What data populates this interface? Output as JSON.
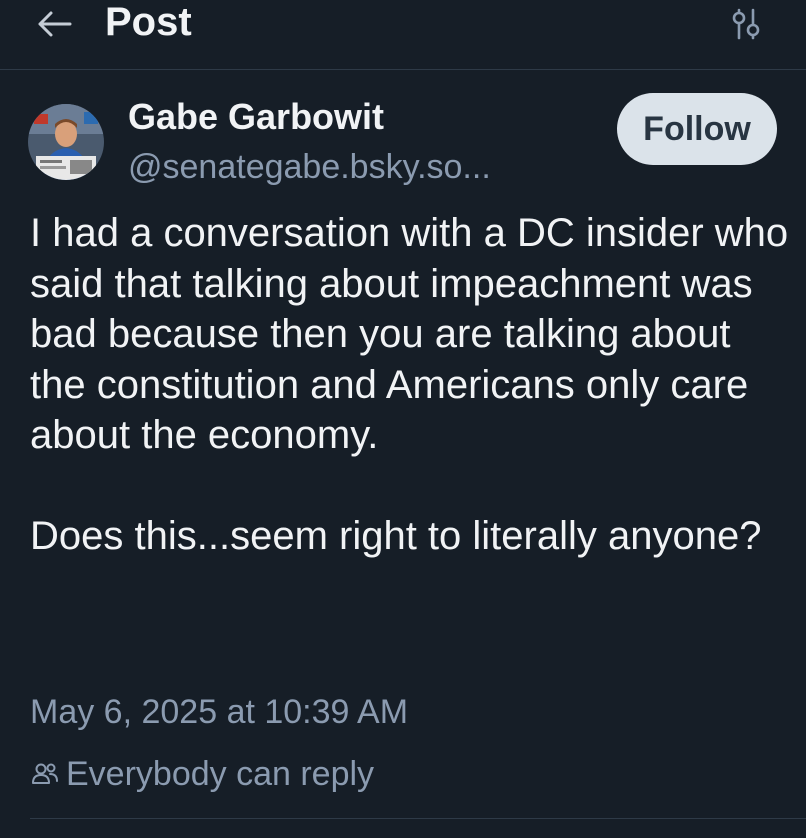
{
  "header": {
    "title": "Post",
    "back_icon": "arrow-left-icon",
    "options_icon": "sliders-icon"
  },
  "author": {
    "name": "Gabe Garbowit",
    "handle": "@senategabe.bsky.so...",
    "follow_label": "Follow"
  },
  "post": {
    "text": "I had a conversation with a DC insider who said that talking about impeachment was bad because then you are talking about the constitution and Americans only care about the economy.\n\nDoes this...seem right to literally anyone?",
    "timestamp": "May 6, 2025 at 10:39 AM",
    "reply_setting": "Everybody can reply",
    "reply_icon": "people-icon"
  },
  "colors": {
    "background": "#161e27",
    "text_primary": "#f1f3f5",
    "text_muted": "#8b9bb0",
    "follow_bg": "#dbe3ea",
    "follow_text": "#283542",
    "divider": "#2e3a47"
  }
}
